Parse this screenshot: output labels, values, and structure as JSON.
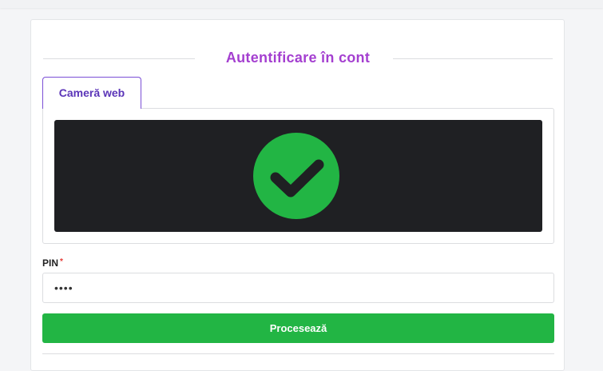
{
  "login": {
    "title": "Autentificare în cont",
    "tabs": [
      {
        "label": "Cameră web",
        "active": true
      }
    ],
    "webcam": {
      "status_icon": "check-circle-icon",
      "status_color": "#22b544",
      "background_color": "#1f2023"
    },
    "pin": {
      "label": "PIN",
      "required_marker": "*",
      "value": "••••"
    },
    "submit_label": "Procesează"
  },
  "colors": {
    "accent": "#a43fd0",
    "tab_accent": "#5b35b8",
    "success": "#22b544"
  }
}
